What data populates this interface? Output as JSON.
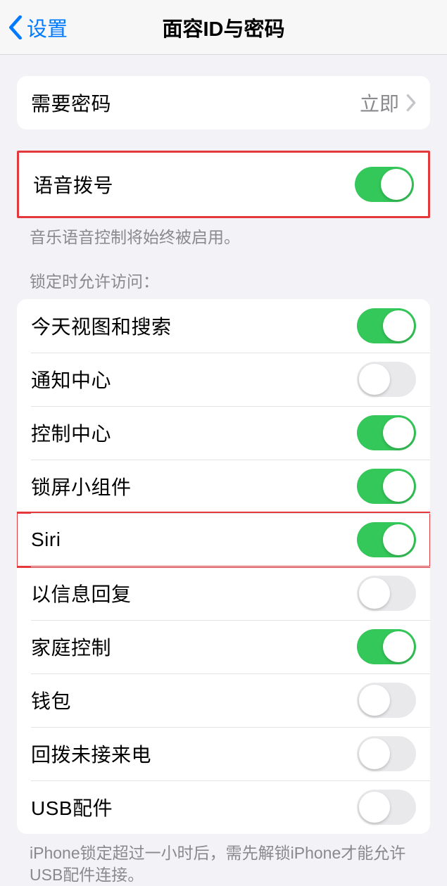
{
  "nav": {
    "back_label": "设置",
    "title": "面容ID与密码"
  },
  "passcode": {
    "label": "需要密码",
    "value": "立即"
  },
  "voice_dial": {
    "label": "语音拨号",
    "enabled": true,
    "footer": "音乐语音控制将始终被启用。"
  },
  "lock_access": {
    "header": "锁定时允许访问：",
    "items": [
      {
        "label": "今天视图和搜索",
        "enabled": true,
        "highlight": false
      },
      {
        "label": "通知中心",
        "enabled": false,
        "highlight": false
      },
      {
        "label": "控制中心",
        "enabled": true,
        "highlight": false
      },
      {
        "label": "锁屏小组件",
        "enabled": true,
        "highlight": false
      },
      {
        "label": "Siri",
        "enabled": true,
        "highlight": true
      },
      {
        "label": "以信息回复",
        "enabled": false,
        "highlight": false
      },
      {
        "label": "家庭控制",
        "enabled": true,
        "highlight": false
      },
      {
        "label": "钱包",
        "enabled": false,
        "highlight": false
      },
      {
        "label": "回拨未接来电",
        "enabled": false,
        "highlight": false
      },
      {
        "label": "USB配件",
        "enabled": false,
        "highlight": false
      }
    ],
    "footer": "iPhone锁定超过一小时后，需先解锁iPhone才能允许USB配件连接。"
  }
}
